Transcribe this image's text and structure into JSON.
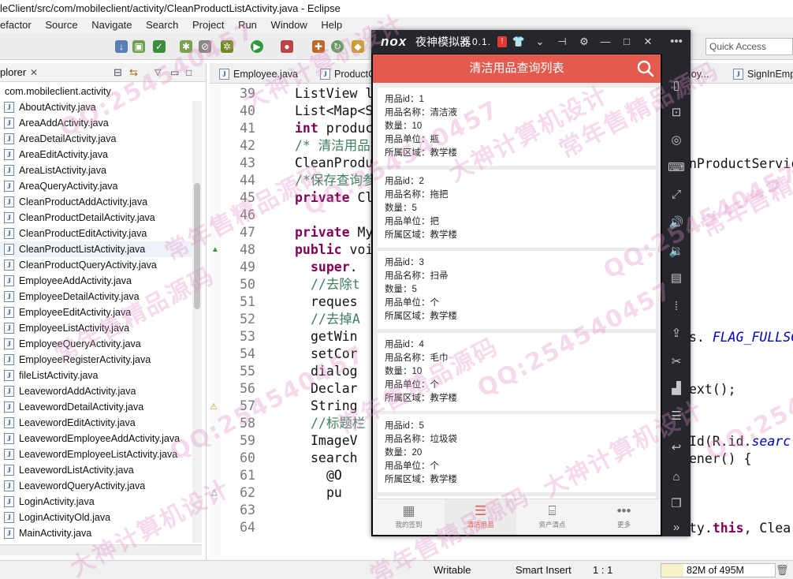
{
  "window_title": "leClient/src/com/mobileclient/activity/CleanProductListActivity.java - Eclipse",
  "menu": [
    "efactor",
    "Source",
    "Navigate",
    "Search",
    "Project",
    "Run",
    "Window",
    "Help"
  ],
  "quick_access_placeholder": "Quick Access",
  "explorer": {
    "title": "plorer",
    "package": "com.mobileclient.activity",
    "files": [
      "AboutActivity.java",
      "AreaAddActivity.java",
      "AreaDetailActivity.java",
      "AreaEditActivity.java",
      "AreaListActivity.java",
      "AreaQueryActivity.java",
      "CleanProductAddActivity.java",
      "CleanProductDetailActivity.java",
      "CleanProductEditActivity.java",
      "CleanProductListActivity.java",
      "CleanProductQueryActivity.java",
      "EmployeeAddActivity.java",
      "EmployeeDetailActivity.java",
      "EmployeeEditActivity.java",
      "EmployeeListActivity.java",
      "EmployeeQueryActivity.java",
      "EmployeeRegisterActivity.java",
      "fileListActivity.java",
      "LeavewordAddActivity.java",
      "LeavewordDetailActivity.java",
      "LeavewordEditActivity.java",
      "LeavewordEmployeeAddActivity.java",
      "LeavewordEmployeeListActivity.java",
      "LeavewordListActivity.java",
      "LeavewordQueryActivity.java",
      "LoginActivity.java",
      "LoginActivityOld.java",
      "MainActivity.java"
    ],
    "selected_index": 9
  },
  "editor_tabs": [
    "Employee.java",
    "ProductC",
    "loy...",
    "SignInEmp"
  ],
  "code": [
    {
      "n": "39",
      "text": "ListView l"
    },
    {
      "n": "40",
      "text": "List<Map<S"
    },
    {
      "n": "41",
      "kw": "int",
      "text": " produc"
    },
    {
      "n": "42",
      "cm": "/* 清洁用品技"
    },
    {
      "n": "43",
      "text": "CleanProdu"
    },
    {
      "n": "44",
      "cm": "/*保存查询参"
    },
    {
      "n": "45",
      "kw": "private",
      "text": " Cl"
    },
    {
      "n": "46",
      "text": ""
    },
    {
      "n": "47",
      "kw": "private",
      "text": " My"
    },
    {
      "n": "48",
      "kw": "public",
      "text": " voi"
    },
    {
      "n": "49",
      "kw": "super",
      "text": "."
    },
    {
      "n": "50",
      "cm": "//去除t"
    },
    {
      "n": "51",
      "text": "reques"
    },
    {
      "n": "52",
      "cm": "//去掉A"
    },
    {
      "n": "53",
      "text": "getWin"
    },
    {
      "n": "54",
      "text": "setCor"
    },
    {
      "n": "55",
      "text": "dialog"
    },
    {
      "n": "56",
      "text": "Declar"
    },
    {
      "n": "57",
      "text": "String"
    },
    {
      "n": "58",
      "cm": "//标题栏"
    },
    {
      "n": "59",
      "text": "ImageV"
    },
    {
      "n": "60",
      "text": "search"
    },
    {
      "n": "61",
      "text": "@O"
    },
    {
      "n": "62",
      "text": "pu"
    },
    {
      "n": "63",
      "text": ""
    },
    {
      "n": "64",
      "text": ""
    }
  ],
  "code_right": {
    "l43": "nProductServic",
    "l53a": "s. ",
    "l53b": "FLAG_FULLSC",
    "l56": "ext();",
    "l59a": "Id(R.id.",
    "l59b": "searc",
    "l60": "ener() {",
    "l64a": "ty.",
    "l64b": "this",
    "l64c": ", Clea"
  },
  "status": {
    "writable": "Writable",
    "insert": "Smart Insert",
    "position": "1 : 1",
    "heap": "82M of 495M"
  },
  "nox": {
    "logo": "nox",
    "name": "夜神模拟器",
    "version": "6.0.1.",
    "badge": "!",
    "app_title": "清洁用品查询列表",
    "records": [
      {
        "id": "用品id：1",
        "name": "用品名称：清洁液",
        "qty": "数量：10",
        "unit": "用品单位：瓶",
        "area": "所属区域：教学楼"
      },
      {
        "id": "用品id：2",
        "name": "用品名称：拖把",
        "qty": "数量：5",
        "unit": "用品单位：把",
        "area": "所属区域：教学楼"
      },
      {
        "id": "用品id：3",
        "name": "用品名称：扫帚",
        "qty": "数量：5",
        "unit": "用品单位：个",
        "area": "所属区域：教学楼"
      },
      {
        "id": "用品id：4",
        "name": "用品名称：毛巾",
        "qty": "数量：10",
        "unit": "用品单位：个",
        "area": "所属区域：教学楼"
      },
      {
        "id": "用品id：5",
        "name": "用品名称：垃圾袋",
        "qty": "数量：20",
        "unit": "用品单位：个",
        "area": "所属区域：教学楼"
      }
    ],
    "nav": [
      "我的签到",
      "清洁用品",
      "资产清点",
      "更多"
    ],
    "active_nav": 1
  },
  "watermarks": [
    "QQ:254540457",
    "常年售精品源码",
    "大神计算机设计"
  ],
  "colors": {
    "app_red": "#e35a4f",
    "nox_dark": "#25272c",
    "keyword": "#7f0055",
    "comment": "#3f7f5f"
  }
}
